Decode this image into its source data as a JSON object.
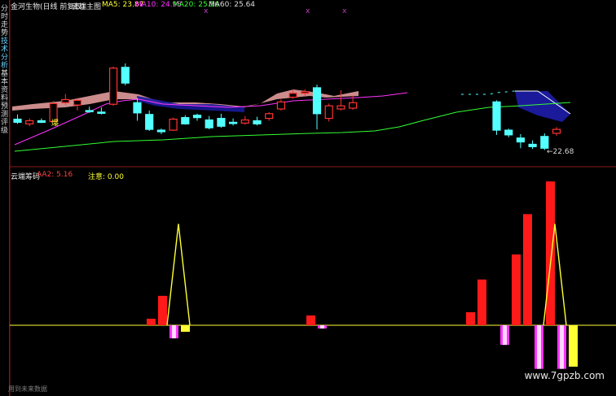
{
  "sidebar": {
    "tabs": [
      {
        "label": "分时走势",
        "active": false
      },
      {
        "label": "技术分析",
        "active": true
      },
      {
        "label": "基本资料",
        "active": false
      },
      {
        "label": "预测评级",
        "active": false
      }
    ]
  },
  "header": {
    "title": "金河生物(日线 前复权)",
    "indicator": "云端主图",
    "ma": [
      {
        "label": "MA5: 23.87",
        "color": "#ffff33"
      },
      {
        "label": "MA10: 24.98",
        "color": "#ff33ff"
      },
      {
        "label": "MA20: 25.56",
        "color": "#33ff33"
      },
      {
        "label": "MA60: 25.64",
        "color": "#dddddd"
      }
    ]
  },
  "main_pane": {
    "low_price_label": "←22.68",
    "bao_label": "爆"
  },
  "sub_pane": {
    "title": "云端筹码",
    "aa2": "AA2: 5.16",
    "zhuyi": "注意: 0.00"
  },
  "watermark": "www.7gpzb.com",
  "footer": "用到未来数据",
  "colors": {
    "up": "#ff3232",
    "down": "#54ffff",
    "ma5": "#ffff33",
    "ma10": "#ff33ff",
    "ma20": "#33ff33",
    "cloud_red": "#f0a5a5",
    "cloud_blue": "#1a1a9a",
    "bar_red": "#ff1a1a",
    "signal": "#ffff33",
    "magenta": "#ff33ff"
  },
  "chart_data": {
    "type": "candlestick",
    "candles": [
      {
        "o": 24.65,
        "h": 24.95,
        "l": 24.35,
        "c": 24.45
      },
      {
        "o": 24.35,
        "h": 24.7,
        "l": 24.2,
        "c": 24.55
      },
      {
        "o": 24.55,
        "h": 24.7,
        "l": 24.4,
        "c": 24.45
      },
      {
        "o": 24.5,
        "h": 25.8,
        "l": 24.45,
        "c": 25.65
      },
      {
        "o": 25.7,
        "h": 26.25,
        "l": 25.55,
        "c": 25.9
      },
      {
        "o": 25.55,
        "h": 26.0,
        "l": 25.2,
        "c": 25.85
      },
      {
        "o": 25.2,
        "h": 25.45,
        "l": 25.05,
        "c": 25.15
      },
      {
        "o": 25.1,
        "h": 25.4,
        "l": 24.95,
        "c": 25.05
      },
      {
        "o": 25.6,
        "h": 28.0,
        "l": 25.5,
        "c": 27.9
      },
      {
        "o": 27.95,
        "h": 28.2,
        "l": 26.8,
        "c": 26.95
      },
      {
        "o": 25.7,
        "h": 26.0,
        "l": 24.55,
        "c": 25.05
      },
      {
        "o": 24.95,
        "h": 25.2,
        "l": 23.9,
        "c": 24.0
      },
      {
        "o": 23.95,
        "h": 24.05,
        "l": 23.7,
        "c": 23.85
      },
      {
        "o": 23.95,
        "h": 24.75,
        "l": 23.9,
        "c": 24.65
      },
      {
        "o": 24.75,
        "h": 24.9,
        "l": 24.3,
        "c": 24.35
      },
      {
        "o": 24.9,
        "h": 25.0,
        "l": 24.55,
        "c": 24.75
      },
      {
        "o": 24.6,
        "h": 24.85,
        "l": 24.0,
        "c": 24.1
      },
      {
        "o": 24.7,
        "h": 25.0,
        "l": 24.1,
        "c": 24.2
      },
      {
        "o": 24.45,
        "h": 24.7,
        "l": 24.25,
        "c": 24.4
      },
      {
        "o": 24.4,
        "h": 24.85,
        "l": 24.3,
        "c": 24.6
      },
      {
        "o": 24.55,
        "h": 24.8,
        "l": 24.25,
        "c": 24.35
      },
      {
        "o": 24.7,
        "h": 25.1,
        "l": 24.55,
        "c": 25.0
      },
      {
        "o": 25.3,
        "h": 25.9,
        "l": 25.2,
        "c": 25.75
      },
      {
        "o": 26.05,
        "h": 26.5,
        "l": 25.95,
        "c": 26.3
      },
      {
        "o": 26.3,
        "h": 26.55,
        "l": 26.15,
        "c": 26.4
      },
      {
        "o": 26.65,
        "h": 26.85,
        "l": 24.0,
        "c": 25.0
      },
      {
        "o": 24.7,
        "h": 25.65,
        "l": 24.5,
        "c": 25.5
      },
      {
        "o": 25.3,
        "h": 26.5,
        "l": 25.2,
        "c": 25.5
      },
      {
        "o": 25.35,
        "h": 26.15,
        "l": 25.25,
        "c": 25.7
      },
      {
        "o": null,
        "h": null,
        "l": null,
        "c": null
      },
      {
        "o": null,
        "h": null,
        "l": null,
        "c": null
      },
      {
        "o": null,
        "h": null,
        "l": null,
        "c": null
      },
      {
        "o": null,
        "h": null,
        "l": null,
        "c": null
      },
      {
        "o": null,
        "h": null,
        "l": null,
        "c": null
      },
      {
        "o": null,
        "h": null,
        "l": null,
        "c": null
      },
      {
        "o": null,
        "h": null,
        "l": null,
        "c": null
      },
      {
        "o": null,
        "h": null,
        "l": null,
        "c": null
      },
      {
        "o": null,
        "h": null,
        "l": null,
        "c": null
      },
      {
        "o": null,
        "h": null,
        "l": null,
        "c": null
      },
      {
        "o": null,
        "h": null,
        "l": null,
        "c": null
      },
      {
        "o": 25.75,
        "h": 25.85,
        "l": 23.65,
        "c": 23.95
      },
      {
        "o": 23.95,
        "h": 24.05,
        "l": 23.5,
        "c": 23.65
      },
      {
        "o": 23.45,
        "h": 23.7,
        "l": 22.8,
        "c": 23.2
      },
      {
        "o": 23.05,
        "h": 23.3,
        "l": 22.75,
        "c": 22.9
      },
      {
        "o": 23.55,
        "h": 23.75,
        "l": 22.68,
        "c": 22.8
      },
      {
        "o": 23.75,
        "h": 24.15,
        "l": 23.6,
        "c": 24.0
      }
    ],
    "ma10": [
      null,
      null,
      null,
      null,
      null,
      null,
      null,
      null,
      null,
      null,
      null,
      null,
      23.4,
      null,
      null,
      null,
      null,
      null,
      null,
      null,
      null,
      null,
      null,
      null,
      null,
      null,
      null,
      null,
      25.15,
      null,
      null,
      null,
      null,
      null,
      null,
      null,
      null,
      null,
      null,
      null,
      null,
      null,
      null,
      null,
      null,
      null
    ],
    "ma20_anchor": [
      22.0,
      23.15,
      23.55,
      24.15,
      25.2
    ],
    "sub_bars": [
      {
        "i": 10,
        "v": 0.6,
        "color": "red"
      },
      {
        "i": 11,
        "v": 2.7,
        "color": "red"
      },
      {
        "i": 12,
        "v": -1.2,
        "color": "magenta"
      },
      {
        "i": 13,
        "v": -0.6,
        "color": "yellow"
      },
      {
        "i": 24,
        "v": 0.9,
        "color": "red"
      },
      {
        "i": 25,
        "v": -0.3,
        "color": "magenta"
      },
      {
        "i": 38,
        "v": 1.2,
        "color": "red"
      },
      {
        "i": 39,
        "v": 4.2,
        "color": "red"
      },
      {
        "i": 41,
        "v": -1.8,
        "color": "magenta"
      },
      {
        "i": 42,
        "v": 6.5,
        "color": "red"
      },
      {
        "i": 43,
        "v": 10.2,
        "color": "red"
      },
      {
        "i": 44,
        "v": -4.0,
        "color": "magenta"
      },
      {
        "i": 45,
        "v": 13.2,
        "color": "red"
      },
      {
        "i": 46,
        "v": -4.0,
        "color": "magenta"
      },
      {
        "i": 47,
        "v": -3.8,
        "color": "yellow"
      }
    ],
    "signal_spikes": [
      {
        "i": 13,
        "v": 9.3
      },
      {
        "i": 46,
        "v": 9.3
      }
    ]
  }
}
